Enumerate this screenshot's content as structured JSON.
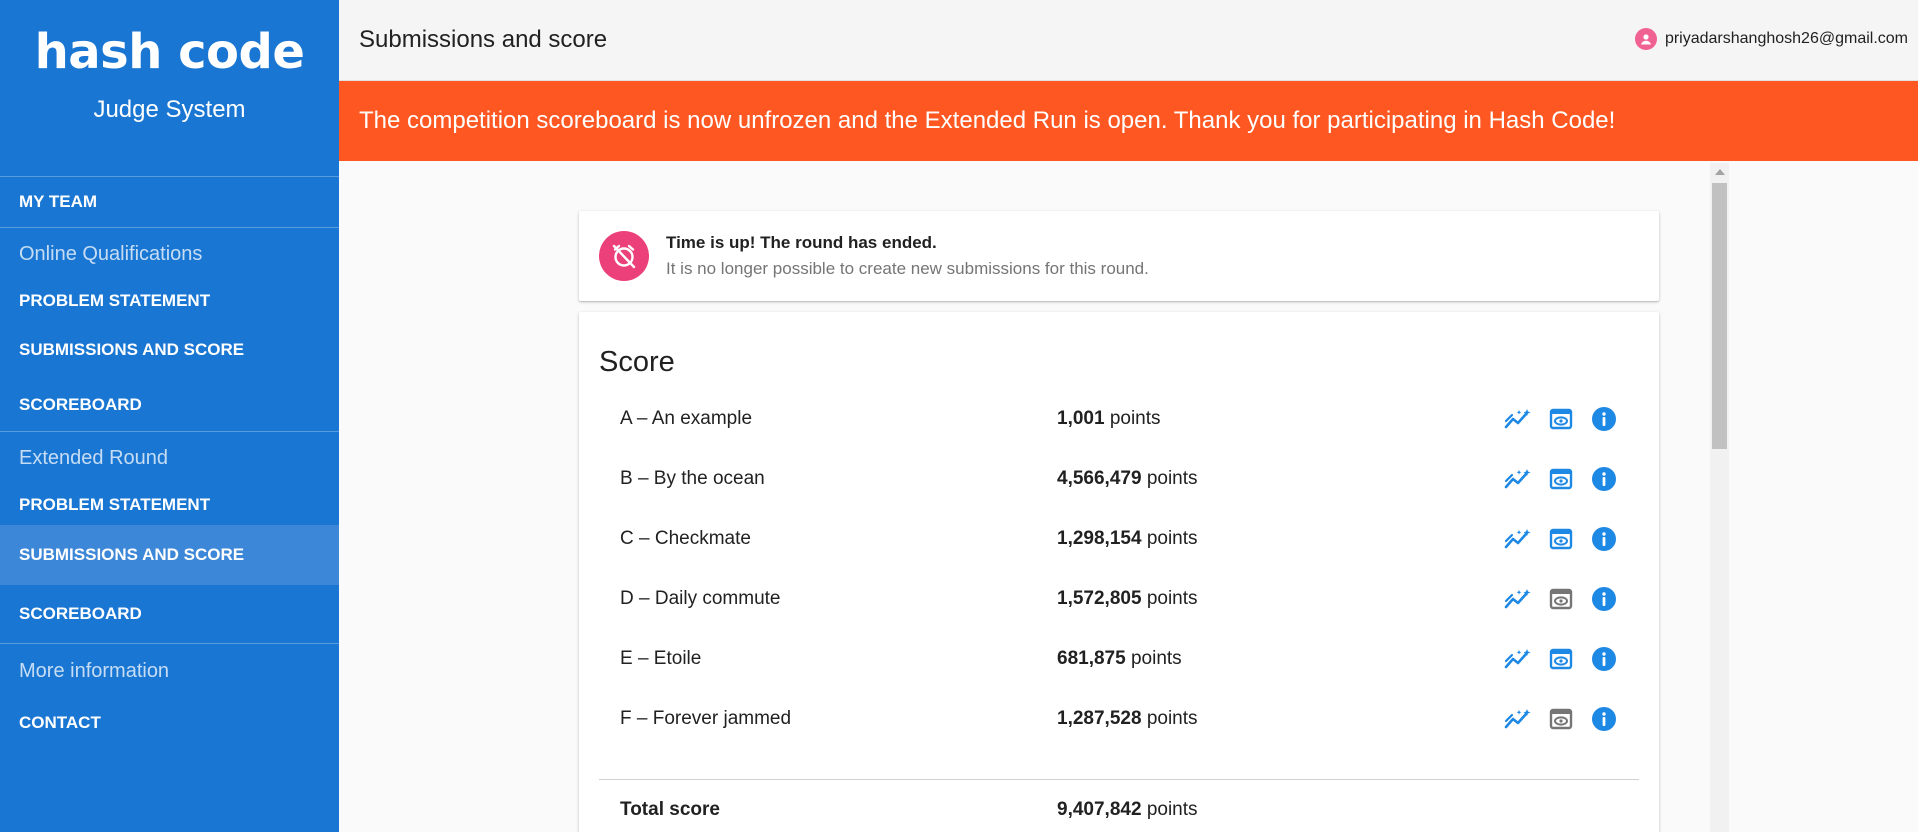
{
  "brand": {
    "logo": "hash code",
    "subtitle": "Judge System"
  },
  "sidebar": {
    "my_team": "MY TEAM",
    "sections": [
      {
        "header": "Online Qualifications",
        "items": [
          "PROBLEM STATEMENT",
          "SUBMISSIONS AND SCORE",
          "SCOREBOARD"
        ]
      },
      {
        "header": "Extended Round",
        "items": [
          "PROBLEM STATEMENT",
          "SUBMISSIONS AND SCORE",
          "SCOREBOARD"
        ]
      },
      {
        "header": "More information",
        "items": [
          "CONTACT"
        ]
      }
    ]
  },
  "header": {
    "title": "Submissions and score",
    "user_email": "priyadarshanghosh26@gmail.com"
  },
  "banner": {
    "text": "The competition scoreboard is now unfrozen and the Extended Run is open. Thank you for participating in Hash Code!"
  },
  "notice": {
    "title": "Time is up! The round has ended.",
    "subtitle": "It is no longer possible to create new submissions for this round."
  },
  "score": {
    "heading": "Score",
    "unit": "points",
    "rows": [
      {
        "name": "A – An example",
        "points": "1,001"
      },
      {
        "name": "B – By the ocean",
        "points": "4,566,479"
      },
      {
        "name": "C – Checkmate",
        "points": "1,298,154"
      },
      {
        "name": "D – Daily commute",
        "points": "1,572,805"
      },
      {
        "name": "E – Etoile",
        "points": "681,875"
      },
      {
        "name": "F – Forever jammed",
        "points": "1,287,528"
      }
    ],
    "total_label": "Total score",
    "total_points": "9,407,842"
  },
  "colors": {
    "sidebar": "#1976d2",
    "banner": "#ff5722",
    "accent_pink": "#ec407a",
    "icon_blue": "#1e88e5",
    "icon_gray": "#757575"
  },
  "icons": {
    "row_actions": [
      "auto-graph-icon",
      "preview-icon",
      "info-icon"
    ],
    "preview_disabled_rows": [
      "D – Daily commute",
      "F – Forever jammed"
    ]
  }
}
